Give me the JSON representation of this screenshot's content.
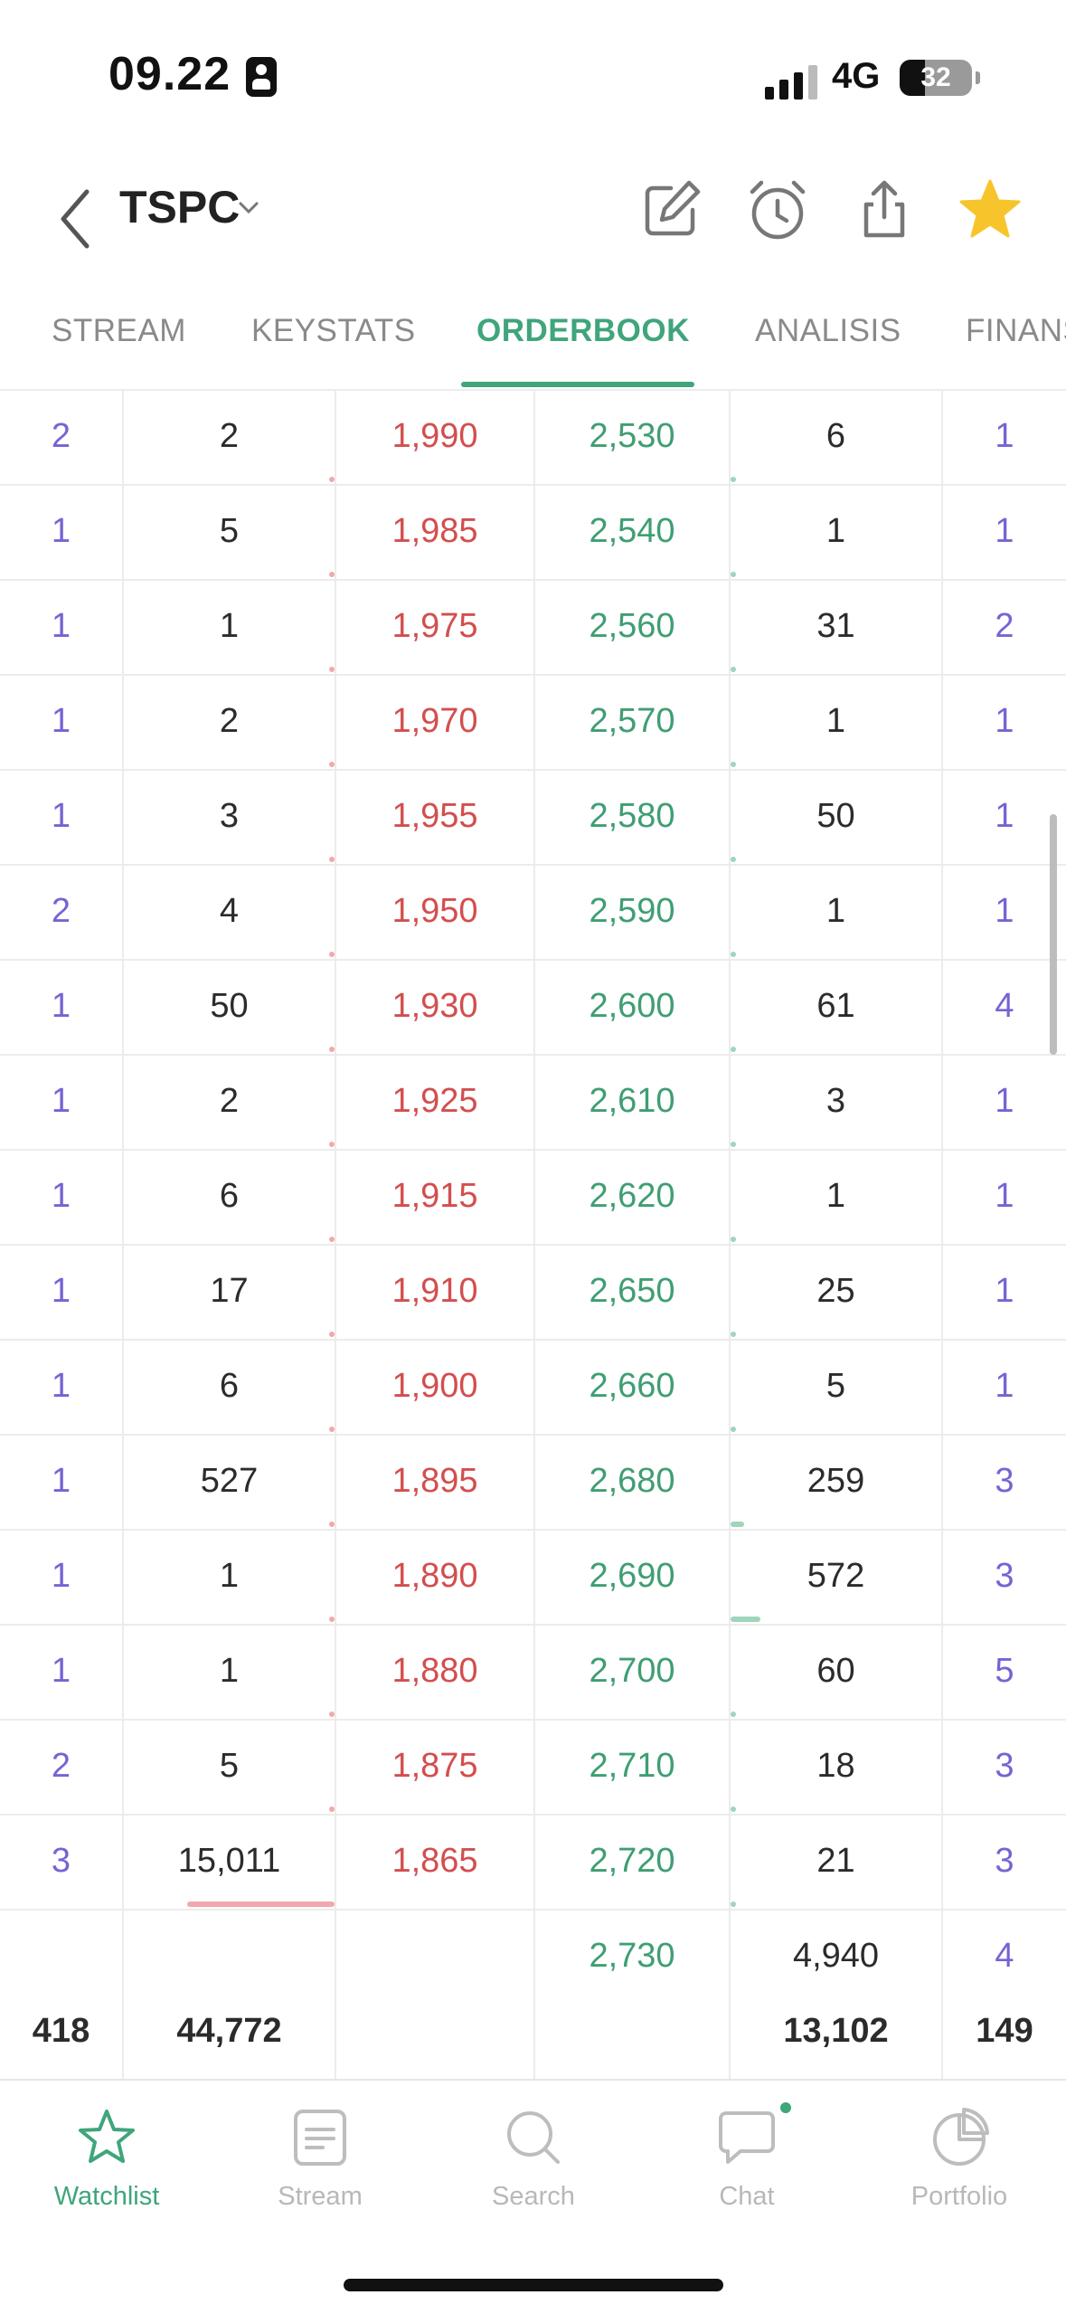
{
  "status": {
    "time": "09.22",
    "network": "4G",
    "battery": "32"
  },
  "header": {
    "ticker": "TSPC"
  },
  "tabs": [
    "STREAM",
    "KEYSTATS",
    "ORDERBOOK",
    "ANALISIS",
    "FINANS"
  ],
  "active_tab": "ORDERBOOK",
  "orderbook": {
    "rows": [
      {
        "bid_freq": "2",
        "bid_lot": "2",
        "bid_price": "1,990",
        "offer_price": "2,530",
        "offer_lot": "6",
        "offer_freq": "1"
      },
      {
        "bid_freq": "1",
        "bid_lot": "5",
        "bid_price": "1,985",
        "offer_price": "2,540",
        "offer_lot": "1",
        "offer_freq": "1"
      },
      {
        "bid_freq": "1",
        "bid_lot": "1",
        "bid_price": "1,975",
        "offer_price": "2,560",
        "offer_lot": "31",
        "offer_freq": "2"
      },
      {
        "bid_freq": "1",
        "bid_lot": "2",
        "bid_price": "1,970",
        "offer_price": "2,570",
        "offer_lot": "1",
        "offer_freq": "1"
      },
      {
        "bid_freq": "1",
        "bid_lot": "3",
        "bid_price": "1,955",
        "offer_price": "2,580",
        "offer_lot": "50",
        "offer_freq": "1"
      },
      {
        "bid_freq": "2",
        "bid_lot": "4",
        "bid_price": "1,950",
        "offer_price": "2,590",
        "offer_lot": "1",
        "offer_freq": "1"
      },
      {
        "bid_freq": "1",
        "bid_lot": "50",
        "bid_price": "1,930",
        "offer_price": "2,600",
        "offer_lot": "61",
        "offer_freq": "4"
      },
      {
        "bid_freq": "1",
        "bid_lot": "2",
        "bid_price": "1,925",
        "offer_price": "2,610",
        "offer_lot": "3",
        "offer_freq": "1"
      },
      {
        "bid_freq": "1",
        "bid_lot": "6",
        "bid_price": "1,915",
        "offer_price": "2,620",
        "offer_lot": "1",
        "offer_freq": "1"
      },
      {
        "bid_freq": "1",
        "bid_lot": "17",
        "bid_price": "1,910",
        "offer_price": "2,650",
        "offer_lot": "25",
        "offer_freq": "1"
      },
      {
        "bid_freq": "1",
        "bid_lot": "6",
        "bid_price": "1,900",
        "offer_price": "2,660",
        "offer_lot": "5",
        "offer_freq": "1"
      },
      {
        "bid_freq": "1",
        "bid_lot": "527",
        "bid_price": "1,895",
        "offer_price": "2,680",
        "offer_lot": "259",
        "offer_freq": "3"
      },
      {
        "bid_freq": "1",
        "bid_lot": "1",
        "bid_price": "1,890",
        "offer_price": "2,690",
        "offer_lot": "572",
        "offer_freq": "3"
      },
      {
        "bid_freq": "1",
        "bid_lot": "1",
        "bid_price": "1,880",
        "offer_price": "2,700",
        "offer_lot": "60",
        "offer_freq": "5"
      },
      {
        "bid_freq": "2",
        "bid_lot": "5",
        "bid_price": "1,875",
        "offer_price": "2,710",
        "offer_lot": "18",
        "offer_freq": "3"
      },
      {
        "bid_freq": "3",
        "bid_lot": "15,011",
        "bid_price": "1,865",
        "offer_price": "2,720",
        "offer_lot": "21",
        "offer_freq": "3"
      },
      {
        "bid_freq": "",
        "bid_lot": "",
        "bid_price": "",
        "offer_price": "2,730",
        "offer_lot": "4,940",
        "offer_freq": "4"
      }
    ],
    "totals": {
      "bid_freq": "418",
      "bid_lot": "44,772",
      "offer_lot": "13,102",
      "offer_freq": "149"
    }
  },
  "nav": [
    {
      "label": "Watchlist",
      "icon": "star-icon",
      "active": true
    },
    {
      "label": "Stream",
      "icon": "stream-icon",
      "active": false
    },
    {
      "label": "Search",
      "icon": "search-icon",
      "active": false
    },
    {
      "label": "Chat",
      "icon": "chat-icon",
      "active": false
    },
    {
      "label": "Portfolio",
      "icon": "portfolio-icon",
      "active": false
    }
  ],
  "colors": {
    "accent": "#3fa57b",
    "bid_price": "#d34e4e",
    "offer_price": "#3f9e72",
    "freq": "#7763d4",
    "favorite": "#f7c52b"
  }
}
